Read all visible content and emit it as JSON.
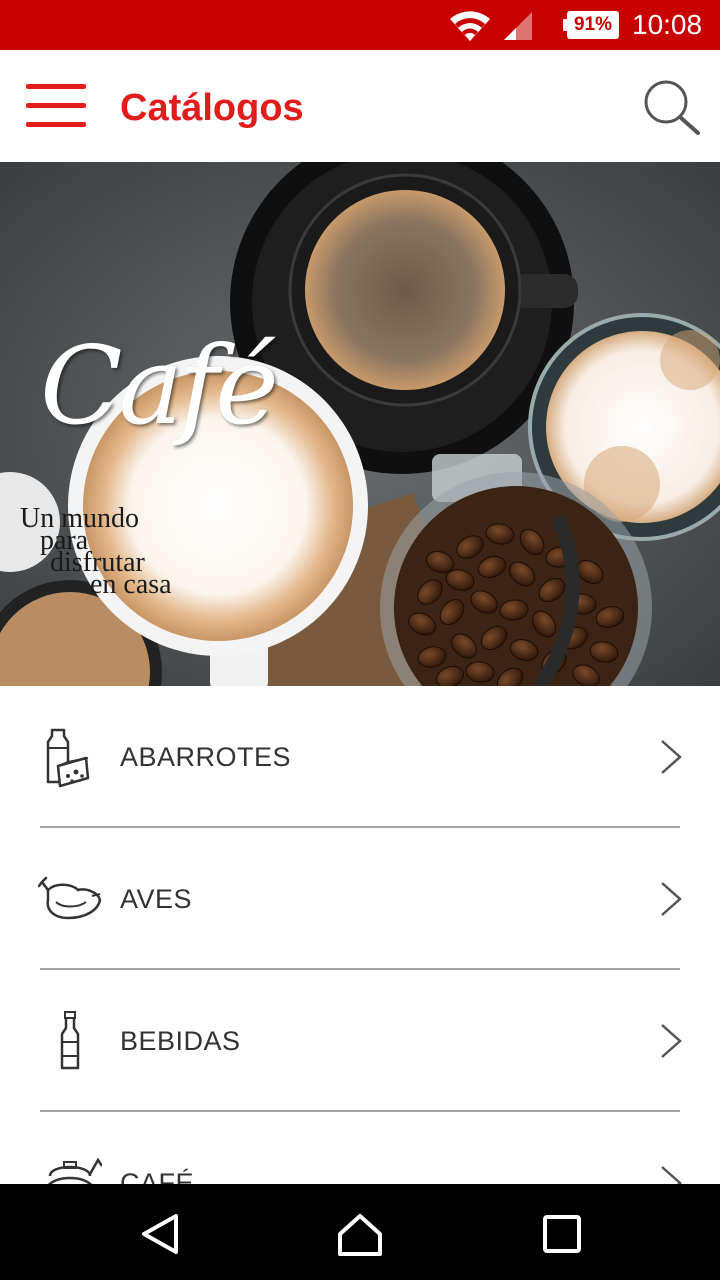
{
  "status_bar": {
    "battery": "91%",
    "time": "10:08"
  },
  "app_bar": {
    "title": "Catálogos",
    "menu_icon": "hamburger-menu-icon",
    "search_icon": "search-icon"
  },
  "banner": {
    "title": "Café",
    "tagline": [
      "Un mundo",
      "para",
      "disfrutar",
      "en casa"
    ]
  },
  "categories": [
    {
      "label": "ABARROTES",
      "icon": "groceries-icon"
    },
    {
      "label": "AVES",
      "icon": "poultry-icon"
    },
    {
      "label": "BEBIDAS",
      "icon": "bottle-icon"
    },
    {
      "label": "CAFÉ",
      "icon": "coffee-pot-icon"
    }
  ],
  "colors": {
    "status_bar": "#c90000",
    "accent": "#e21b1b",
    "text": "#333333",
    "divider": "#a6a6a6",
    "nav_bar": "#000000"
  }
}
